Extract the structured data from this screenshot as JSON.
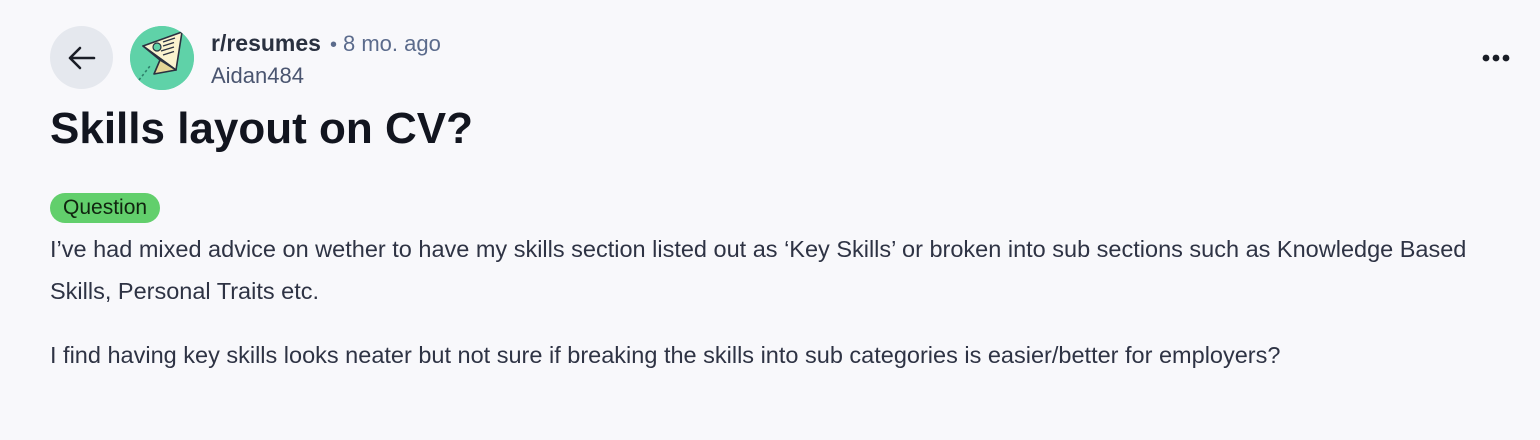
{
  "post": {
    "subreddit": "r/resumes",
    "separator": "•",
    "time": "8 mo. ago",
    "author": "Aidan484",
    "title": "Skills layout on CV?",
    "flair": "Question",
    "flair_color": "#62cf6c",
    "paragraphs": [
      "I’ve had mixed advice on wether to have my skills section listed out as ‘Key Skills’ or broken into sub sections such as Knowledge Based Skills, Personal Traits etc.",
      "I find having key skills looks neater but not sure if breaking the skills into sub categories is easier/better for employers?"
    ]
  },
  "avatar": {
    "icon": "resume-paper-plane-icon",
    "background": "#5fd2a8"
  },
  "icons": {
    "back": "arrow-left-icon",
    "more": "more-horizontal-icon"
  }
}
